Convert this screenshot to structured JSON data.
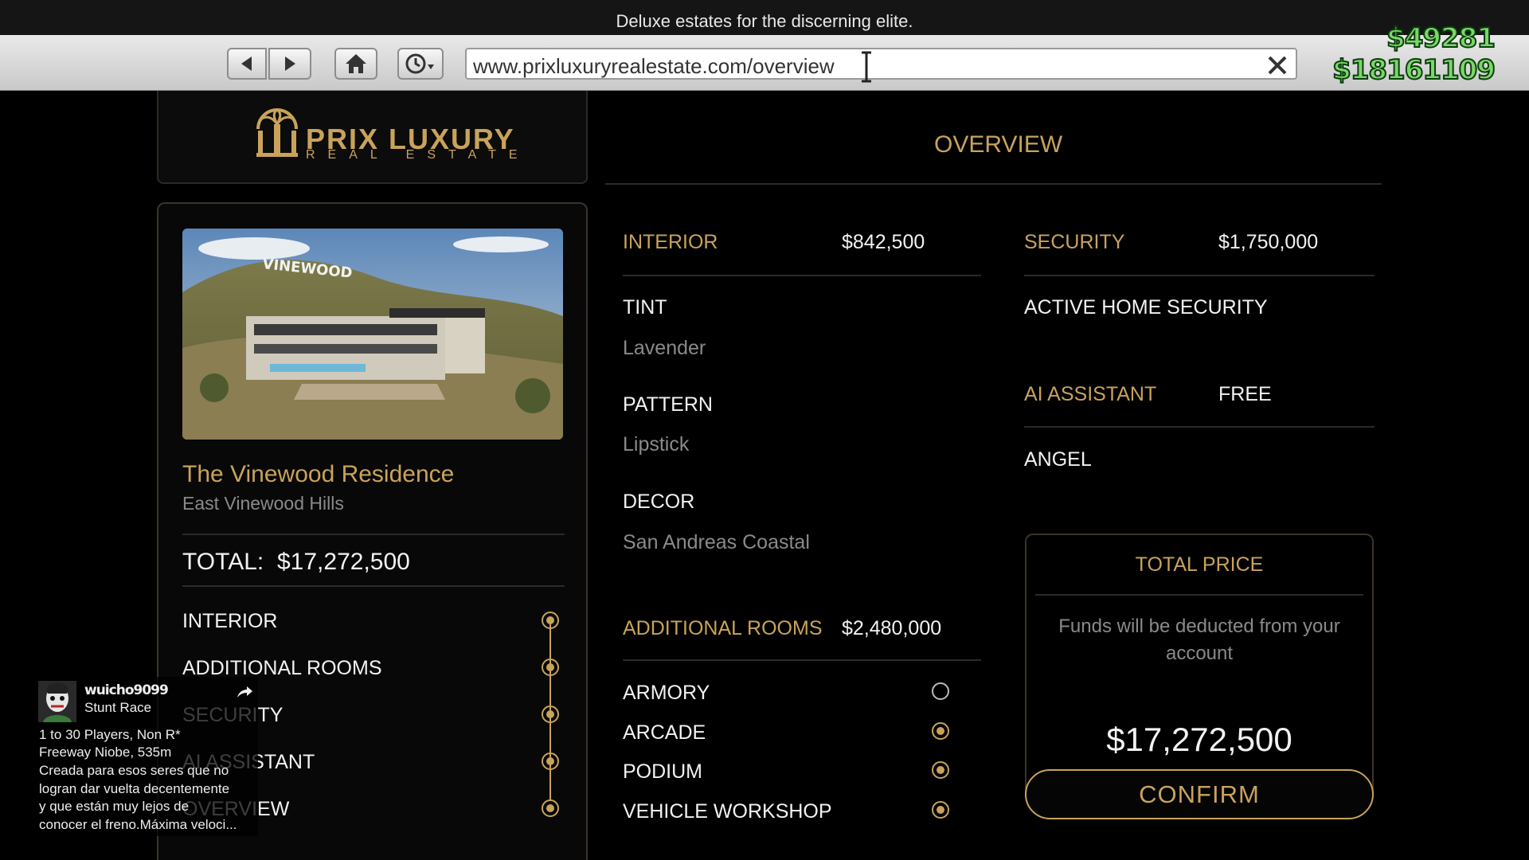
{
  "tagline": "Deluxe estates for the discerning elite.",
  "browser": {
    "url": "www.prixluxuryrealestate.com/overview"
  },
  "money": {
    "cash": "$49281",
    "bank": "$18161109"
  },
  "logo": {
    "name": "PRIX LUXURY",
    "sub": "REAL ESTATE"
  },
  "property": {
    "name": "The Vinewood Residence",
    "location": "East Vinewood Hills",
    "total_label": "TOTAL:",
    "total_value": "$17,272,500",
    "sign_text": "VINEWOOD"
  },
  "steps": [
    {
      "label": "INTERIOR",
      "done": true
    },
    {
      "label": "ADDITIONAL ROOMS",
      "done": true
    },
    {
      "label": "SECURITY",
      "done": true
    },
    {
      "label": "AI ASSISTANT",
      "done": true
    },
    {
      "label": "OVERVIEW",
      "done": false
    }
  ],
  "overview": {
    "title": "OVERVIEW",
    "interior": {
      "label": "INTERIOR",
      "price": "$842,500",
      "items": [
        {
          "name": "TINT",
          "value": "Lavender"
        },
        {
          "name": "PATTERN",
          "value": "Lipstick"
        },
        {
          "name": "DECOR",
          "value": "San Andreas Coastal"
        }
      ]
    },
    "rooms": {
      "label": "ADDITIONAL ROOMS",
      "price": "$2,480,000",
      "items": [
        {
          "name": "ARMORY",
          "selected": false
        },
        {
          "name": "ARCADE",
          "selected": true
        },
        {
          "name": "PODIUM",
          "selected": true
        },
        {
          "name": "VEHICLE WORKSHOP",
          "selected": true
        }
      ]
    },
    "security": {
      "label": "SECURITY",
      "price": "$1,750,000",
      "item": "ACTIVE HOME SECURITY"
    },
    "ai": {
      "label": "AI ASSISTANT",
      "price": "FREE",
      "item": "ANGEL"
    },
    "total": {
      "label": "TOTAL PRICE",
      "note": "Funds will be deducted from your account",
      "value": "$17,272,500",
      "confirm": "CONFIRM"
    }
  },
  "notification": {
    "user": "wuicho9099",
    "type": "Stunt Race",
    "lines": [
      "1 to 30 Players, Non R*",
      "Freeway Niobe, 535m",
      "Creada para esos seres que no",
      "logran dar vuelta decentemente",
      "y que están muy lejos de",
      "conocer el freno.Máxima veloci..."
    ]
  },
  "colors": {
    "accent": "#c9a35b",
    "money": "#7bd66a"
  }
}
